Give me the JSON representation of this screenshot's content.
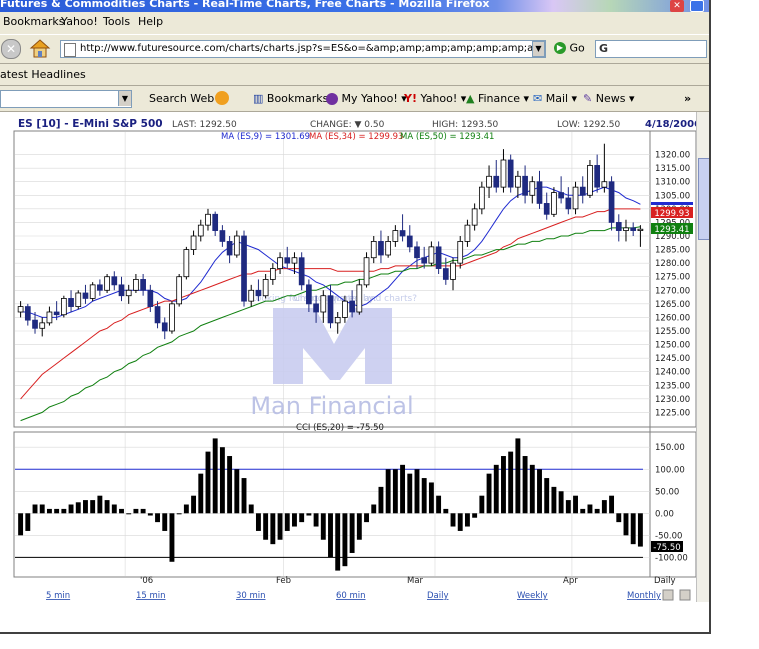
{
  "window": {
    "title": "Futures & Commodities Charts - Real-Time Charts, Free Charts - Mozilla Firefox"
  },
  "menu": {
    "items": [
      "Bookmarks",
      "Yahoo!",
      "Tools",
      "Help"
    ]
  },
  "nav": {
    "url": "http://www.futuresource.com/charts/charts.jsp?s=ES&o=&amp;amp;amp;amp;amp;amp;amp;amp;a=D",
    "go_label": "Go",
    "search_value": "G"
  },
  "headlines_label": "atest Headlines",
  "toolbar": {
    "search_web": "Search Web",
    "bookmarks": "Bookmarks",
    "my_yahoo": "My Yahoo!",
    "yahoo": "Yahoo!",
    "finance": "Finance",
    "mail": "Mail",
    "news": "News",
    "more": "»"
  },
  "chart_header": {
    "symbol": "ES [10] - E-Mini S&P 500",
    "last": "LAST: 1292.50",
    "change": "CHANGE: ▼ 0.50",
    "high": "HIGH: 1293.50",
    "low": "LOW: 1292.50",
    "date": "4/18/2006",
    "ma9": "MA (ES,9) = 1301.69",
    "ma34": "MA (ES,34) = 1299.93",
    "ma50": "MA (ES,50) = 1293.41",
    "overlay_text": "Looking for stock quotes and charts?",
    "powered": "Chart powered by:",
    "logo_text": "Man Financial",
    "cci_label": "CCI (ES,20) = -75.50",
    "price_flags": [
      "1299.93",
      "1293.41"
    ],
    "cci_flag": "-75.50"
  },
  "time_axis": [
    "'06",
    "Feb",
    "Mar",
    "Apr"
  ],
  "period_links": [
    "5 min",
    "15 min",
    "30 min",
    "60 min",
    "Daily",
    "Weekly",
    "Monthly"
  ],
  "period_current": "Daily",
  "colors": {
    "up": "#ffffff",
    "down": "#1f2a80",
    "ma9": "#1f2ad0",
    "ma34": "#d82020",
    "ma50": "#108010",
    "grid": "#d8d8d8",
    "cci_band": "#1f2ad0"
  },
  "chart_data": [
    {
      "type": "candlestick",
      "title": "ES [10] - E-Mini S&P 500",
      "y_ticks": [
        1225,
        1230,
        1235,
        1240,
        1245,
        1250,
        1255,
        1260,
        1265,
        1270,
        1275,
        1280,
        1285,
        1290,
        1295,
        1300,
        1305,
        1310,
        1315,
        1320
      ],
      "ylim": [
        1220,
        1325
      ],
      "y_scale": "linear",
      "grid": true,
      "candles": [
        [
          1262,
          1266,
          1260,
          1264
        ],
        [
          1264,
          1265,
          1257,
          1259
        ],
        [
          1259,
          1262,
          1254,
          1256
        ],
        [
          1256,
          1260,
          1253,
          1258
        ],
        [
          1258,
          1264,
          1257,
          1262
        ],
        [
          1262,
          1266,
          1259,
          1261
        ],
        [
          1261,
          1268,
          1260,
          1267
        ],
        [
          1267,
          1270,
          1262,
          1264
        ],
        [
          1264,
          1270,
          1263,
          1269
        ],
        [
          1269,
          1272,
          1265,
          1267
        ],
        [
          1267,
          1273,
          1266,
          1272
        ],
        [
          1272,
          1274,
          1268,
          1270
        ],
        [
          1270,
          1276,
          1269,
          1275
        ],
        [
          1275,
          1277,
          1270,
          1272
        ],
        [
          1272,
          1275,
          1266,
          1268
        ],
        [
          1268,
          1272,
          1265,
          1270
        ],
        [
          1270,
          1276,
          1269,
          1274
        ],
        [
          1274,
          1276,
          1268,
          1270
        ],
        [
          1270,
          1272,
          1262,
          1264
        ],
        [
          1264,
          1266,
          1256,
          1258
        ],
        [
          1258,
          1260,
          1252,
          1255
        ],
        [
          1255,
          1266,
          1254,
          1265
        ],
        [
          1265,
          1276,
          1264,
          1275
        ],
        [
          1275,
          1286,
          1274,
          1285
        ],
        [
          1285,
          1292,
          1283,
          1290
        ],
        [
          1290,
          1296,
          1288,
          1294
        ],
        [
          1294,
          1300,
          1292,
          1298
        ],
        [
          1298,
          1299,
          1290,
          1292
        ],
        [
          1292,
          1294,
          1286,
          1288
        ],
        [
          1288,
          1290,
          1280,
          1283
        ],
        [
          1283,
          1292,
          1282,
          1290
        ],
        [
          1290,
          1292,
          1264,
          1266
        ],
        [
          1266,
          1272,
          1264,
          1270
        ],
        [
          1270,
          1274,
          1266,
          1268
        ],
        [
          1268,
          1276,
          1267,
          1274
        ],
        [
          1274,
          1280,
          1272,
          1278
        ],
        [
          1278,
          1284,
          1276,
          1282
        ],
        [
          1282,
          1286,
          1278,
          1280
        ],
        [
          1280,
          1284,
          1276,
          1282
        ],
        [
          1282,
          1284,
          1270,
          1272
        ],
        [
          1272,
          1274,
          1262,
          1265
        ],
        [
          1265,
          1268,
          1258,
          1262
        ],
        [
          1262,
          1270,
          1258,
          1268
        ],
        [
          1268,
          1272,
          1256,
          1258
        ],
        [
          1258,
          1262,
          1254,
          1260
        ],
        [
          1260,
          1268,
          1258,
          1266
        ],
        [
          1266,
          1270,
          1260,
          1262
        ],
        [
          1262,
          1274,
          1261,
          1272
        ],
        [
          1272,
          1284,
          1271,
          1282
        ],
        [
          1282,
          1290,
          1280,
          1288
        ],
        [
          1288,
          1292,
          1280,
          1283
        ],
        [
          1283,
          1290,
          1282,
          1288
        ],
        [
          1288,
          1294,
          1286,
          1292
        ],
        [
          1292,
          1298,
          1288,
          1290
        ],
        [
          1290,
          1294,
          1284,
          1286
        ],
        [
          1286,
          1288,
          1278,
          1282
        ],
        [
          1282,
          1286,
          1278,
          1280
        ],
        [
          1280,
          1288,
          1279,
          1286
        ],
        [
          1286,
          1288,
          1276,
          1278
        ],
        [
          1278,
          1282,
          1272,
          1274
        ],
        [
          1274,
          1282,
          1270,
          1280
        ],
        [
          1280,
          1290,
          1278,
          1288
        ],
        [
          1288,
          1296,
          1286,
          1294
        ],
        [
          1294,
          1302,
          1292,
          1300
        ],
        [
          1300,
          1310,
          1298,
          1308
        ],
        [
          1308,
          1316,
          1304,
          1312
        ],
        [
          1312,
          1318,
          1306,
          1308
        ],
        [
          1308,
          1322,
          1306,
          1318
        ],
        [
          1318,
          1320,
          1306,
          1308
        ],
        [
          1308,
          1314,
          1304,
          1312
        ],
        [
          1312,
          1316,
          1302,
          1305
        ],
        [
          1305,
          1312,
          1302,
          1310
        ],
        [
          1310,
          1314,
          1300,
          1302
        ],
        [
          1302,
          1306,
          1296,
          1298
        ],
        [
          1298,
          1308,
          1297,
          1306
        ],
        [
          1306,
          1312,
          1302,
          1304
        ],
        [
          1304,
          1308,
          1298,
          1300
        ],
        [
          1300,
          1310,
          1298,
          1308
        ],
        [
          1308,
          1312,
          1302,
          1305
        ],
        [
          1305,
          1318,
          1304,
          1316
        ],
        [
          1316,
          1320,
          1306,
          1308
        ],
        [
          1308,
          1324,
          1306,
          1310
        ],
        [
          1310,
          1312,
          1292,
          1295
        ],
        [
          1295,
          1298,
          1288,
          1292
        ],
        [
          1292,
          1296,
          1288,
          1293
        ],
        [
          1293,
          1295,
          1290,
          1292
        ],
        [
          1292,
          1294,
          1286,
          1292.5
        ]
      ],
      "series": [
        {
          "name": "MA (ES,9)",
          "values": [
            1262,
            1262,
            1261,
            1260,
            1260,
            1260,
            1261,
            1262,
            1263,
            1264,
            1266,
            1267,
            1268,
            1269,
            1270,
            1270,
            1270,
            1270,
            1270,
            1269,
            1267,
            1266,
            1266,
            1267,
            1270,
            1273,
            1277,
            1281,
            1284,
            1286,
            1288,
            1287,
            1286,
            1285,
            1283,
            1281,
            1279,
            1278,
            1277,
            1276,
            1275,
            1273,
            1272,
            1270,
            1268,
            1266,
            1265,
            1264,
            1265,
            1267,
            1269,
            1271,
            1274,
            1277,
            1279,
            1281,
            1282,
            1283,
            1284,
            1283,
            1282,
            1282,
            1283,
            1285,
            1288,
            1292,
            1296,
            1300,
            1303,
            1305,
            1306,
            1307,
            1308,
            1308,
            1307,
            1306,
            1305,
            1305,
            1305,
            1306,
            1307,
            1308,
            1307,
            1306,
            1304,
            1303,
            1301.69
          ]
        },
        {
          "name": "MA (ES,34)",
          "values": [
            1230,
            1233,
            1236,
            1239,
            1241,
            1243,
            1245,
            1247,
            1249,
            1251,
            1253,
            1255,
            1256,
            1258,
            1259,
            1261,
            1262,
            1263,
            1264,
            1265,
            1266,
            1266,
            1267,
            1268,
            1269,
            1270,
            1271,
            1272,
            1273,
            1274,
            1275,
            1276,
            1276,
            1277,
            1277,
            1277,
            1278,
            1278,
            1278,
            1278,
            1278,
            1278,
            1278,
            1278,
            1277,
            1277,
            1277,
            1277,
            1277,
            1277,
            1278,
            1278,
            1279,
            1279,
            1279,
            1279,
            1279,
            1279,
            1279,
            1279,
            1279,
            1279,
            1280,
            1281,
            1282,
            1283,
            1284,
            1286,
            1287,
            1289,
            1290,
            1291,
            1292,
            1293,
            1294,
            1295,
            1296,
            1297,
            1297,
            1298,
            1299,
            1299,
            1300,
            1300,
            1300,
            1300,
            1299.93
          ]
        },
        {
          "name": "MA (ES,50)",
          "values": [
            1222,
            1223,
            1224,
            1225,
            1227,
            1228,
            1229,
            1231,
            1232,
            1234,
            1235,
            1237,
            1238,
            1240,
            1241,
            1243,
            1244,
            1246,
            1247,
            1249,
            1250,
            1251,
            1253,
            1254,
            1255,
            1257,
            1258,
            1259,
            1260,
            1261,
            1262,
            1263,
            1264,
            1265,
            1266,
            1266,
            1267,
            1268,
            1268,
            1269,
            1270,
            1270,
            1271,
            1272,
            1272,
            1273,
            1273,
            1274,
            1274,
            1275,
            1276,
            1276,
            1277,
            1277,
            1278,
            1278,
            1279,
            1279,
            1280,
            1280,
            1281,
            1281,
            1282,
            1283,
            1283,
            1284,
            1285,
            1285,
            1286,
            1287,
            1287,
            1288,
            1288,
            1289,
            1289,
            1290,
            1290,
            1291,
            1291,
            1292,
            1292,
            1292,
            1293,
            1293,
            1293,
            1293,
            1293.41
          ]
        }
      ]
    },
    {
      "type": "bar",
      "title": "CCI (ES,20) = -75.50",
      "y_ticks": [
        150,
        100,
        50,
        0,
        -50,
        -100
      ],
      "ylim": [
        -140,
        180
      ],
      "bands": [
        100,
        -100
      ],
      "grid": true,
      "values": [
        -50,
        -40,
        20,
        20,
        10,
        10,
        10,
        20,
        25,
        30,
        30,
        40,
        30,
        20,
        10,
        0,
        10,
        10,
        -5,
        -20,
        -40,
        -110,
        0,
        20,
        40,
        90,
        140,
        170,
        150,
        130,
        100,
        80,
        20,
        -40,
        -60,
        -70,
        -60,
        -40,
        -30,
        -20,
        -5,
        -30,
        -60,
        -100,
        -130,
        -120,
        -90,
        -60,
        -20,
        20,
        60,
        100,
        100,
        110,
        90,
        100,
        80,
        70,
        40,
        10,
        -30,
        -40,
        -30,
        -10,
        40,
        90,
        110,
        130,
        140,
        170,
        130,
        110,
        100,
        80,
        60,
        50,
        30,
        40,
        10,
        20,
        10,
        30,
        40,
        -20,
        -50,
        -70,
        -75.5
      ]
    }
  ]
}
